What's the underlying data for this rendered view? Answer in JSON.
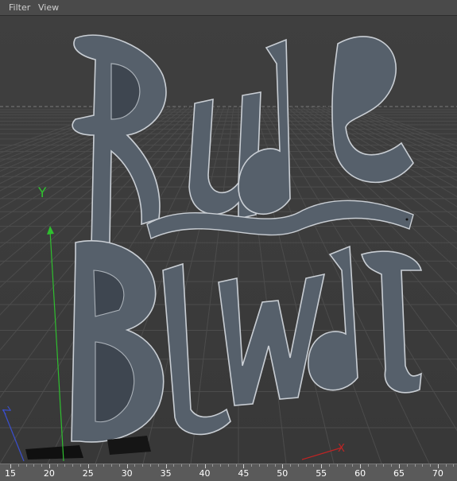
{
  "menubar": {
    "items": [
      {
        "label": "Filter"
      },
      {
        "label": "View"
      }
    ]
  },
  "viewport": {
    "axes": {
      "y_label": "Y",
      "x_label": "X"
    },
    "object_text": [
      "Rude",
      "Blvd"
    ],
    "colors": {
      "background": "#3c3c3c",
      "grid": "#4b4b4b",
      "object": "#5a6470",
      "object_edge": "#c9ced4",
      "y_axis": "#2fbf2f",
      "x_axis": "#c02424"
    }
  },
  "timeline": {
    "ticks": [
      "15",
      "20",
      "25",
      "30",
      "35",
      "40",
      "45",
      "50",
      "55",
      "60",
      "65",
      "70"
    ]
  }
}
